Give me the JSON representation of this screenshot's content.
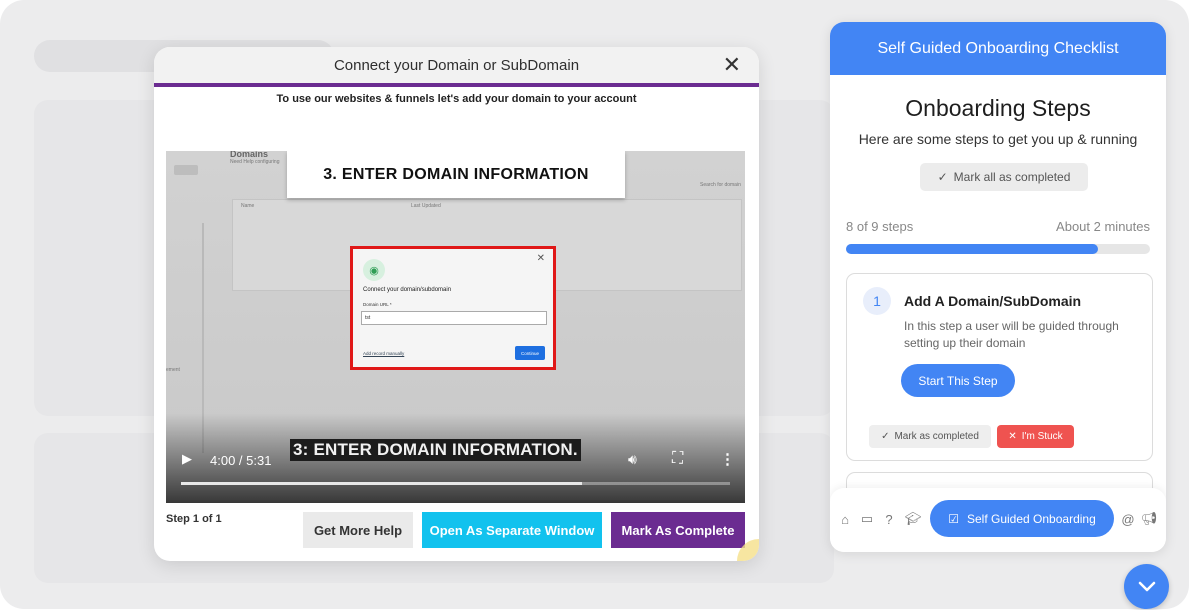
{
  "modal": {
    "title": "Connect your Domain or SubDomain",
    "close_icon": "close-icon",
    "subtitle": "To use our websites & funnels let's add your domain to your account",
    "video": {
      "title_card": "3. ENTER DOMAIN INFORMATION",
      "dialog_title": "Connect your domain/subdomain",
      "field_label": "Domain URL *",
      "field_value": "tst",
      "link_text": "Add record manually",
      "continue_label": "Continue",
      "bg_heading": "Domains",
      "bg_help": "Need Help configuring",
      "bg_search": "Search for domain",
      "bg_col_name": "Name",
      "bg_col_updated": "Last Updated",
      "bg_side": "ement",
      "caption": "3: ENTER DOMAIN INFORMATION.",
      "time": "4:00 / 5:31",
      "progress": 0.73
    },
    "step_text": "Step 1 of 1",
    "buttons": {
      "help": "Get More Help",
      "open": "Open As Separate Window",
      "complete": "Mark As Complete"
    }
  },
  "panel": {
    "header": "Self Guided Onboarding Checklist",
    "heading": "Onboarding Steps",
    "subheading": "Here are some steps to get you up & running",
    "mark_all": "Mark all as completed",
    "steps_count": "8 of 9 steps",
    "time_estimate": "About 2 minutes",
    "progress": 0.83,
    "step": {
      "number": "1",
      "title": "Add A Domain/SubDomain",
      "description": "In this step a user will be guided through setting up their domain",
      "start": "Start This Step",
      "mark_completed": "Mark as completed",
      "stuck": "I'm Stuck"
    },
    "nav": {
      "main": "Self Guided Onboarding"
    }
  },
  "colors": {
    "accent_blue": "#4285f4",
    "purple": "#6b2c91",
    "cyan": "#12c2ee",
    "red": "#ef5350"
  }
}
